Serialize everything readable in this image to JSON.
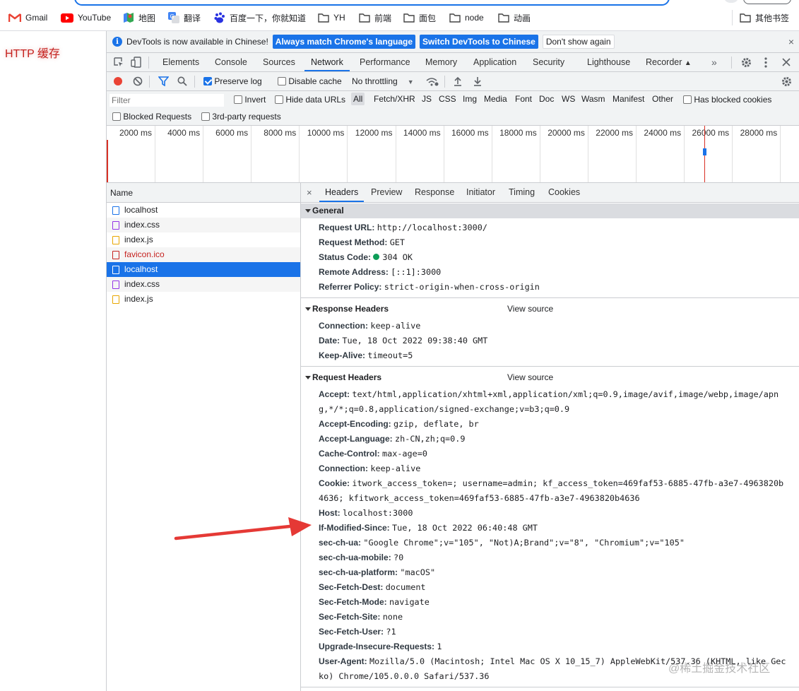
{
  "bookmarks": [
    {
      "label": "Gmail",
      "icon": "gmail-icon"
    },
    {
      "label": "YouTube",
      "icon": "youtube-icon"
    },
    {
      "label": "地图",
      "icon": "maps-icon"
    },
    {
      "label": "翻译",
      "icon": "translate-icon"
    },
    {
      "label": "百度一下，你就知道",
      "icon": "baidu-icon"
    },
    {
      "label": "YH",
      "icon": "folder-icon"
    },
    {
      "label": "前端",
      "icon": "folder-icon"
    },
    {
      "label": "面包",
      "icon": "folder-icon"
    },
    {
      "label": "node",
      "icon": "folder-icon"
    },
    {
      "label": "动画",
      "icon": "folder-icon"
    },
    {
      "label": "其他书签",
      "icon": "folder-icon"
    }
  ],
  "page": {
    "heading": "HTTP 缓存"
  },
  "infobar": {
    "message": "DevTools is now available in Chinese!",
    "btn_match": "Always match Chrome's language",
    "btn_switch": "Switch DevTools to Chinese",
    "btn_dont": "Don't show again",
    "close": "×"
  },
  "tabs": [
    "Elements",
    "Console",
    "Sources",
    "Network",
    "Performance",
    "Memory",
    "Application",
    "Security",
    "Lighthouse",
    "Recorder"
  ],
  "active_tab": "Network",
  "tabs_more": "»",
  "toolbar": {
    "preserve_log": "Preserve log",
    "disable_cache": "Disable cache",
    "throttling": "No throttling"
  },
  "filter": {
    "placeholder": "Filter",
    "invert": "Invert",
    "hide_data_urls": "Hide data URLs",
    "types": [
      "All",
      "Fetch/XHR",
      "JS",
      "CSS",
      "Img",
      "Media",
      "Font",
      "Doc",
      "WS",
      "Wasm",
      "Manifest",
      "Other"
    ],
    "has_blocked_cookies": "Has blocked cookies",
    "blocked_requests": "Blocked Requests",
    "third_party": "3rd-party requests"
  },
  "overview_ticks": [
    "2000 ms",
    "4000 ms",
    "6000 ms",
    "8000 ms",
    "10000 ms",
    "12000 ms",
    "14000 ms",
    "16000 ms",
    "18000 ms",
    "20000 ms",
    "22000 ms",
    "24000 ms",
    "26000 ms",
    "28000 ms",
    "30"
  ],
  "requests": {
    "header": "Name",
    "rows": [
      {
        "name": "localhost",
        "type": "doc"
      },
      {
        "name": "index.css",
        "type": "css"
      },
      {
        "name": "index.js",
        "type": "js"
      },
      {
        "name": "favicon.ico",
        "type": "error"
      },
      {
        "name": "localhost",
        "type": "doc",
        "selected": true
      },
      {
        "name": "index.css",
        "type": "css"
      },
      {
        "name": "index.js",
        "type": "js"
      }
    ]
  },
  "detail_tabs": [
    "Headers",
    "Preview",
    "Response",
    "Initiator",
    "Timing",
    "Cookies"
  ],
  "detail_close": "×",
  "general": {
    "title": "General",
    "rows": [
      {
        "k": "Request URL:",
        "v": "http://localhost:3000/"
      },
      {
        "k": "Request Method:",
        "v": "GET"
      },
      {
        "k": "Status Code:",
        "v": "304 OK"
      },
      {
        "k": "Remote Address:",
        "v": "[::1]:3000"
      },
      {
        "k": "Referrer Policy:",
        "v": "strict-origin-when-cross-origin"
      }
    ]
  },
  "response_headers": {
    "title": "Response Headers",
    "view_source": "View source",
    "rows": [
      {
        "k": "Connection:",
        "v": "keep-alive"
      },
      {
        "k": "Date:",
        "v": "Tue, 18 Oct 2022 09:38:40 GMT"
      },
      {
        "k": "Keep-Alive:",
        "v": "timeout=5"
      }
    ]
  },
  "request_headers": {
    "title": "Request Headers",
    "view_source": "View source",
    "rows": [
      {
        "k": "Accept:",
        "v": "text/html,application/xhtml+xml,application/xml;q=0.9,image/avif,image/webp,image/apn",
        "v2": "g,*/*;q=0.8,application/signed-exchange;v=b3;q=0.9"
      },
      {
        "k": "Accept-Encoding:",
        "v": "gzip, deflate, br"
      },
      {
        "k": "Accept-Language:",
        "v": "zh-CN,zh;q=0.9"
      },
      {
        "k": "Cache-Control:",
        "v": "max-age=0"
      },
      {
        "k": "Connection:",
        "v": "keep-alive"
      },
      {
        "k": "Cookie:",
        "v": "itwork_access_token=; username=admin; kf_access_token=469faf53-6885-47fb-a3e7-4963820b",
        "v2": "4636; kfitwork_access_token=469faf53-6885-47fb-a3e7-4963820b4636"
      },
      {
        "k": "Host:",
        "v": "localhost:3000"
      },
      {
        "k": "If-Modified-Since:",
        "v": "Tue, 18 Oct 2022 06:40:48 GMT"
      },
      {
        "k": "sec-ch-ua:",
        "v": "\"Google Chrome\";v=\"105\", \"Not)A;Brand\";v=\"8\", \"Chromium\";v=\"105\""
      },
      {
        "k": "sec-ch-ua-mobile:",
        "v": "?0"
      },
      {
        "k": "sec-ch-ua-platform:",
        "v": "\"macOS\""
      },
      {
        "k": "Sec-Fetch-Dest:",
        "v": "document"
      },
      {
        "k": "Sec-Fetch-Mode:",
        "v": "navigate"
      },
      {
        "k": "Sec-Fetch-Site:",
        "v": "none"
      },
      {
        "k": "Sec-Fetch-User:",
        "v": "?1"
      },
      {
        "k": "Upgrade-Insecure-Requests:",
        "v": "1"
      },
      {
        "k": "User-Agent:",
        "v": "Mozilla/5.0 (Macintosh; Intel Mac OS X 10_15_7) AppleWebKit/537.36 (KHTML, like Gec",
        "v2": "ko) Chrome/105.0.0.0 Safari/537.36"
      }
    ]
  },
  "watermark": "@稀土掘金技术社区",
  "colors": {
    "accent": "#1a73e8",
    "arrow": "#e53935",
    "status_ok": "#0d9d58",
    "error": "#c5221f"
  }
}
